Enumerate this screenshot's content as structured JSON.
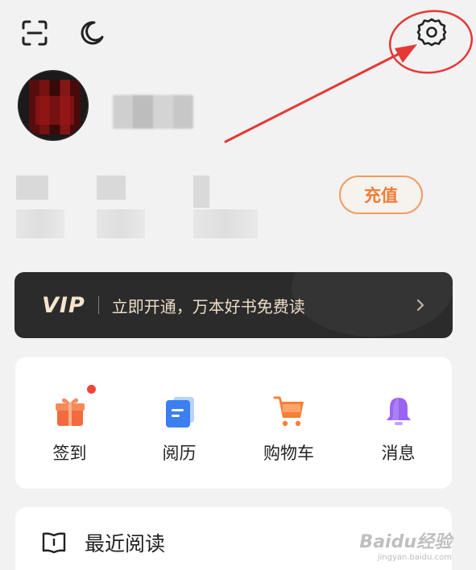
{
  "topbar": {
    "scan_icon": "scan-icon",
    "night_mode_icon": "moon-icon",
    "settings_icon": "gear-icon"
  },
  "profile": {
    "recharge_label": "充值"
  },
  "vip": {
    "badge": "VIP",
    "text": "立即开通，万本好书免费读"
  },
  "quick_actions": [
    {
      "label": "签到",
      "icon": "gift-icon",
      "has_dot": true
    },
    {
      "label": "阅历",
      "icon": "reading-history-icon",
      "has_dot": false
    },
    {
      "label": "购物车",
      "icon": "cart-icon",
      "has_dot": false
    },
    {
      "label": "消息",
      "icon": "bell-icon",
      "has_dot": false
    }
  ],
  "recent": {
    "title": "最近阅读"
  },
  "watermark": {
    "text": "Baidu经验",
    "sub": "jingyan.baidu.com"
  },
  "colors": {
    "accent_orange": "#ef7d34",
    "vip_bg": "#2b2b2b",
    "annotation_red": "#e53935"
  }
}
